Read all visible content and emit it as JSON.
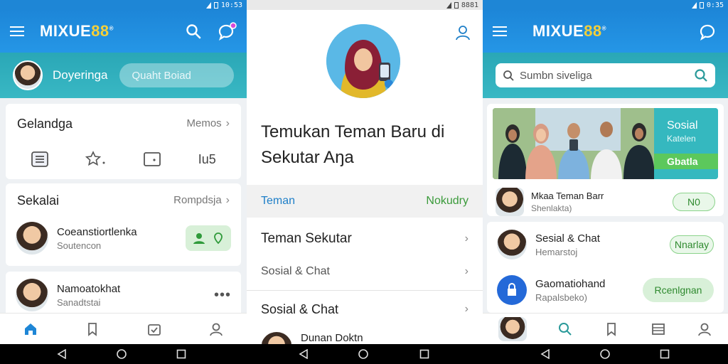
{
  "panel1": {
    "status_time": "10:53",
    "brand_main": "MIXUE",
    "brand_num": "88",
    "brand_reg": "®",
    "user_name": "Doyeringa",
    "search_placeholder": "Quaht Boiad",
    "card1": {
      "title": "Gelandga",
      "more": "Memos",
      "icons": [
        "list-icon",
        "star-icon",
        "tablet-icon"
      ],
      "count_label": "Iu5"
    },
    "card2": {
      "title": "Sekalai",
      "more": "Rompdsja",
      "contact_name": "Coeanstiortlenka",
      "contact_sub": "Soutencon"
    },
    "card3": {
      "contact_name": "Namoatokhat",
      "contact_sub": "Sanadtstai"
    },
    "nav": [
      "home-icon",
      "bookmark-icon",
      "calendar-check-icon",
      "profile-icon"
    ]
  },
  "panel2": {
    "status_time": "8881",
    "headline": "Temukan Teman Baru di Sekutar Aŋa",
    "tab_left": "Teman",
    "tab_right": "Nokudry",
    "item1_label": "Teman Sekutar",
    "item2_label": "Sosial & Chat",
    "item3_label": "Sosial & Chat",
    "item4_label": "Dunan Doktn"
  },
  "panel3": {
    "status_time": "0:35",
    "brand_main": "MIXUE",
    "brand_num": "88",
    "brand_reg": "®",
    "search_placeholder": "Sumbn siveliga",
    "banner_text1": "Sosial",
    "banner_text2": "Katelen",
    "banner_badge": "Gbatla",
    "row1_title": "Mkaa Teman Barr",
    "row1_sub": "Shenlakta)",
    "row1_btn": "N0",
    "row2_title": "Sesial & Chat",
    "row2_sub": "Hemarstoj",
    "row2_btn": "Nnarlay",
    "row3_title": "Gaomatiohand",
    "row3_sub": "Rapalsbeko)",
    "row3_btn": "Rcenlgnan",
    "nav": [
      "avatar",
      "search-icon",
      "bookmark-icon",
      "list-icon",
      "profile-icon"
    ]
  },
  "colors": {
    "appbar_blue": "#1d86d8",
    "teal": "#2aa7b6",
    "green_accent": "#2f8a2f",
    "tab_blue": "#1e7fc8",
    "tab_green": "#3a9a3a"
  }
}
